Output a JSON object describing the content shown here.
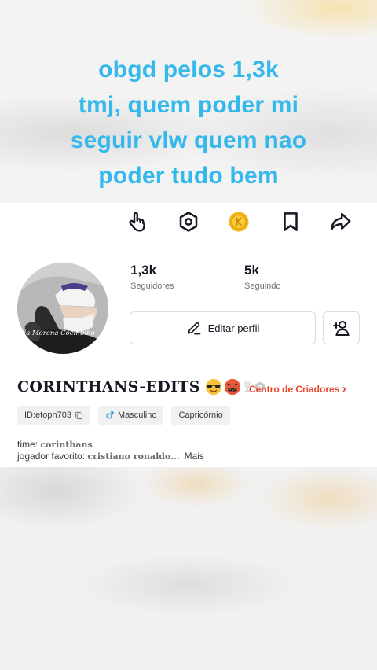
{
  "caption": {
    "line1": "obgd pelos 1,3k",
    "line2": "tmj, quem poder mi",
    "line3": "seguir vlw quem nao",
    "line4": "poder tudo bem"
  },
  "toolbar": {
    "icons": [
      "tap-hand-icon",
      "gear-icon",
      "coin-icon",
      "bookmark-icon",
      "share-icon"
    ]
  },
  "avatar": {
    "watermark_text": "a da Morena Coelhinho"
  },
  "stats": {
    "followers_count": "1,3k",
    "followers_label": "Seguidores",
    "following_count": "5k",
    "following_label": "Seguindo"
  },
  "actions": {
    "edit_profile_label": "Editar perfil",
    "add_friend_icon": "add-user-icon"
  },
  "profile": {
    "display_name": "CORINTHANS-EDITS",
    "creator_center_label": "Centro de Criadores",
    "creator_chevron": "›"
  },
  "tags": {
    "id_text": "ID:etopn703",
    "gender_text": "Masculino",
    "sign_text": "Capricórnio"
  },
  "bio": {
    "line1_prefix": "time: ",
    "line1_value": "corinthans",
    "line2_prefix": "jogador favorito: ",
    "line2_value": "cristiano ronaldo...",
    "more_label": "Mais"
  },
  "colors": {
    "caption": "#35b8ec",
    "creator_link": "#e8442d",
    "gender_icon": "#2aa0dc",
    "coin": "#f3b515"
  }
}
